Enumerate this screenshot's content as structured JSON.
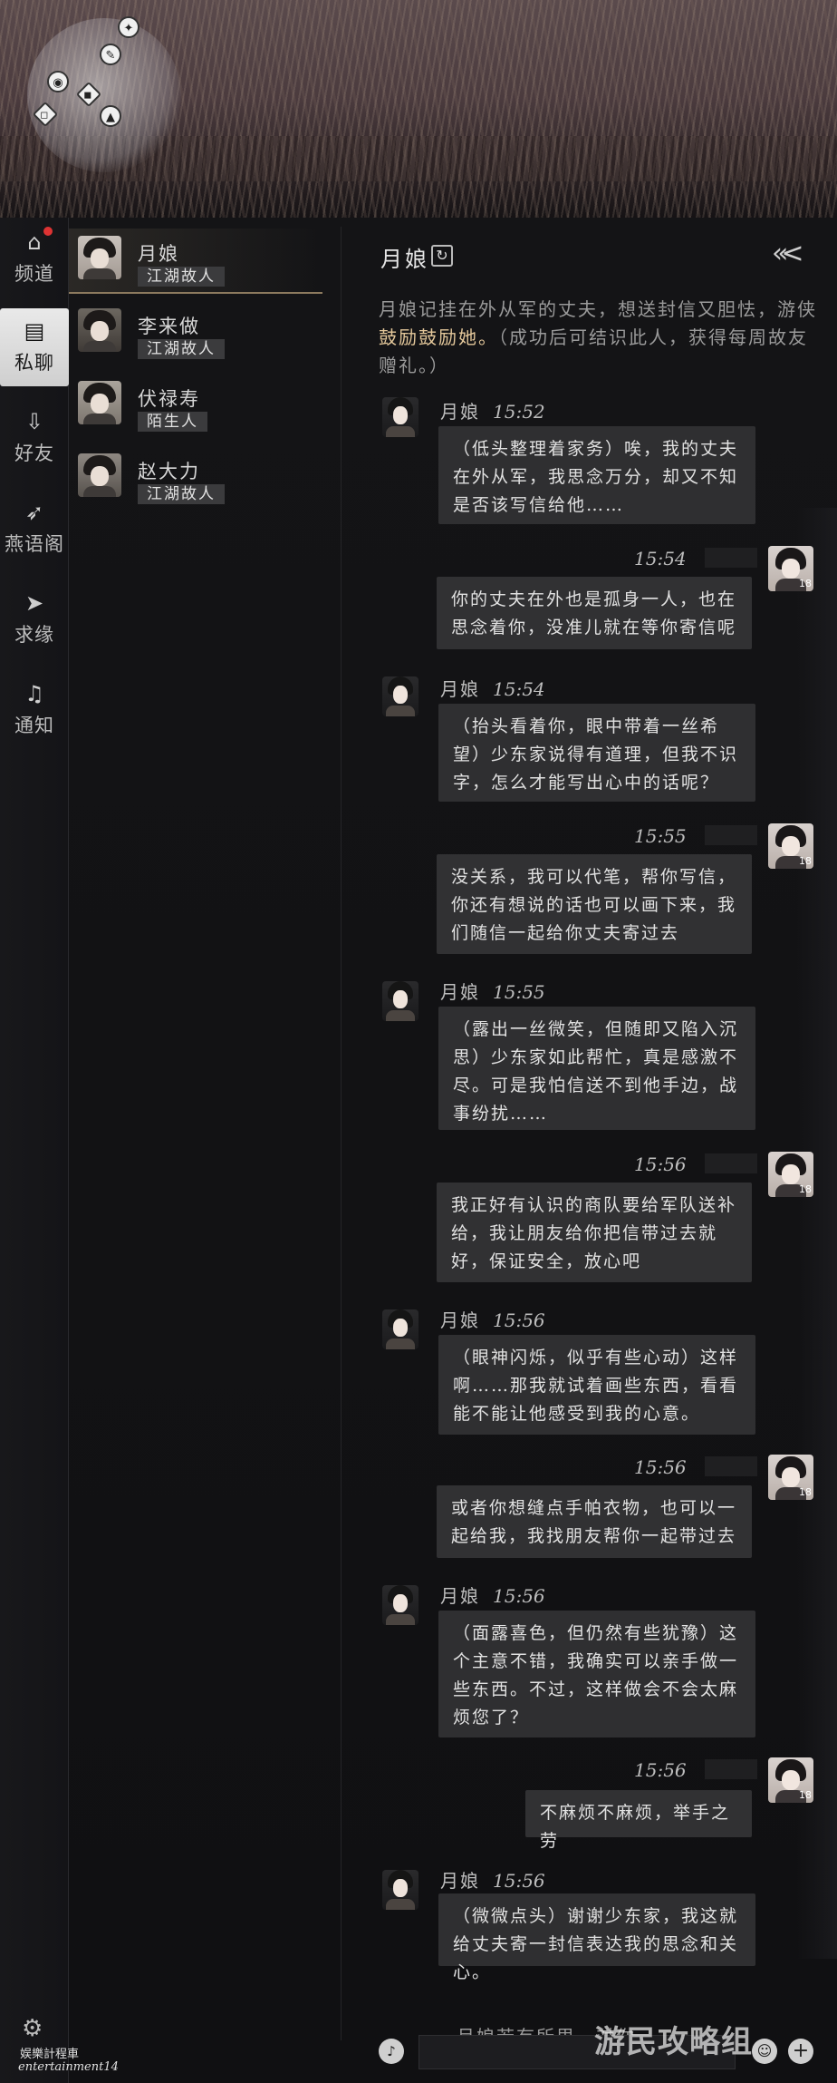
{
  "nav": {
    "items": [
      {
        "label": "频道",
        "icon": "home-icon"
      },
      {
        "label": "私聊",
        "icon": "chat-icon"
      },
      {
        "label": "好友",
        "icon": "friend-icon"
      },
      {
        "label": "燕语阁",
        "icon": "swallow-icon"
      },
      {
        "label": "求缘",
        "icon": "send-icon"
      },
      {
        "label": "通知",
        "icon": "bell-icon"
      }
    ]
  },
  "contacts": [
    {
      "name": "月娘",
      "tag": "江湖故人"
    },
    {
      "name": "李来做",
      "tag": "江湖故人"
    },
    {
      "name": "伏禄寿",
      "tag": "陌生人"
    },
    {
      "name": "赵大力",
      "tag": "江湖故人"
    }
  ],
  "chat": {
    "title": "月娘",
    "intro_pre": "月娘记挂在外从军的丈夫，想送封信又胆怯，游侠",
    "intro_hl": "鼓励鼓励她。",
    "intro_post": "（成功后可结识此人，获得每周故友赠礼。）",
    "messages": [
      {
        "from": "npc",
        "name": "月娘",
        "time": "15:52",
        "text": "（低头整理着家务）唉，我的丈夫在外从军，我思念万分，却又不知是否该写信给他……"
      },
      {
        "from": "me",
        "time": "15:54",
        "text": "你的丈夫在外也是孤身一人，也在思念着你，没准儿就在等你寄信呢"
      },
      {
        "from": "npc",
        "name": "月娘",
        "time": "15:54",
        "text": "（抬头看着你，眼中带着一丝希望）少东家说得有道理，但我不识字，怎么才能写出心中的话呢？"
      },
      {
        "from": "me",
        "time": "15:55",
        "text": "没关系，我可以代笔，帮你写信，你还有想说的话也可以画下来，我们随信一起给你丈夫寄过去"
      },
      {
        "from": "npc",
        "name": "月娘",
        "time": "15:55",
        "text": "（露出一丝微笑，但随即又陷入沉思）少东家如此帮忙，真是感激不尽。可是我怕信送不到他手边，战事纷扰……"
      },
      {
        "from": "me",
        "time": "15:56",
        "text": "我正好有认识的商队要给军队送补给，我让朋友给你把信带过去就好，保证安全，放心吧"
      },
      {
        "from": "npc",
        "name": "月娘",
        "time": "15:56",
        "text": "（眼神闪烁，似乎有些心动）这样啊……那我就试着画些东西，看看能不能让他感受到我的心意。"
      },
      {
        "from": "me",
        "time": "15:56",
        "text": "或者你想缝点手帕衣物，也可以一起给我，我找朋友帮你一起带过去"
      },
      {
        "from": "npc",
        "name": "月娘",
        "time": "15:56",
        "text": "（面露喜色，但仍然有些犹豫）这个主意不错，我确实可以亲手做一些东西。不过，这样做会不会太麻烦您了？"
      },
      {
        "from": "me",
        "time": "15:56",
        "text": "不麻烦不麻烦，举手之劳"
      },
      {
        "from": "npc",
        "name": "月娘",
        "time": "15:56",
        "text": "（微微点头）谢谢少东家，我这就给丈夫寄一封信表达我的思念和关心。"
      }
    ],
    "hint": "月娘若有所思，对你",
    "me_level": "18"
  },
  "watermark": {
    "left_line1": "娱樂計程車",
    "left_line2": "entertainment14",
    "right": "游民攻略组"
  }
}
